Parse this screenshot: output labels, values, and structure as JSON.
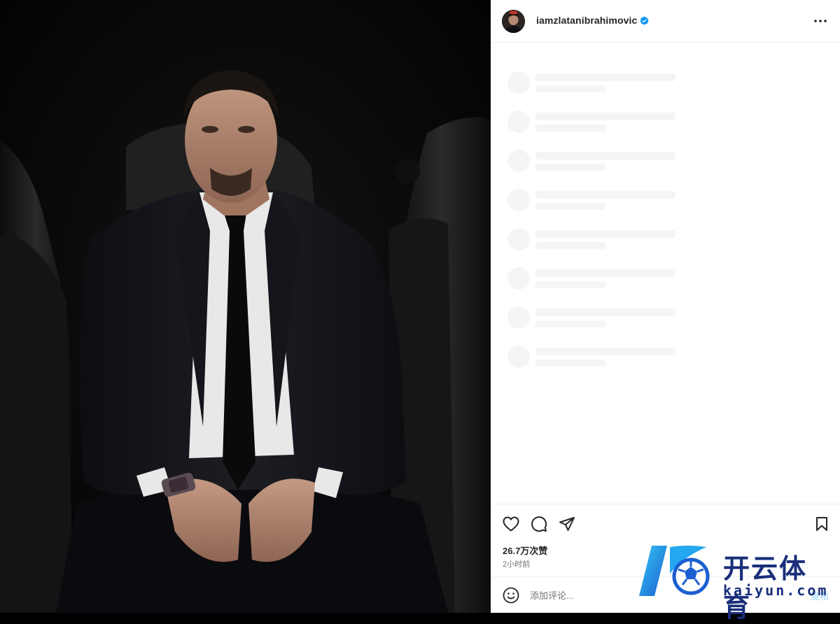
{
  "post": {
    "username": "iamzlatanibrahimovic",
    "verified": true,
    "likes": "26.7万次赞",
    "time": "2小时前",
    "comment_placeholder": "添加评论...",
    "post_label": "发布"
  },
  "icons": {
    "more": "more-horizontal-icon",
    "like": "heart-icon",
    "comment": "comment-bubble-icon",
    "share": "paper-plane-icon",
    "save": "bookmark-icon",
    "emoji": "smiley-icon"
  },
  "watermark": {
    "brand_cn": "开云体育",
    "brand_en": "kaiyun.com"
  },
  "colors": {
    "verified": "#0095f6",
    "text": "#262626",
    "secondary": "#737373",
    "post_disabled": "#b2dffc",
    "brand": "#1a2e7a"
  }
}
